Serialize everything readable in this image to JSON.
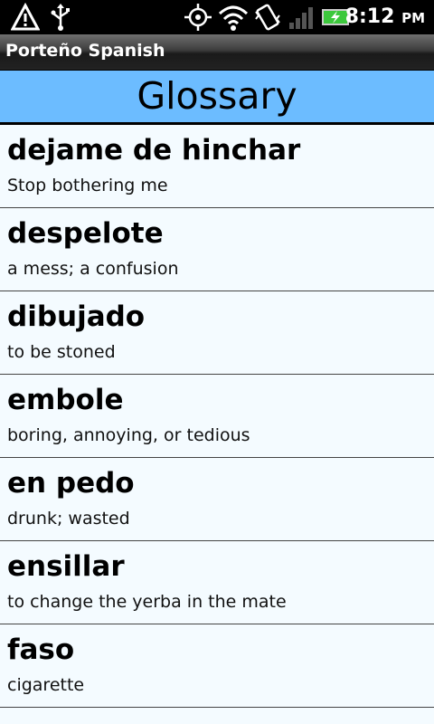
{
  "status_bar": {
    "time": "8:12",
    "ampm": "PM",
    "icons": [
      "warning-icon",
      "usb-icon",
      "gps-icon",
      "wifi-icon",
      "vibrate-icon",
      "signal-icon",
      "battery-charging-icon"
    ]
  },
  "app": {
    "title": "Porteño Spanish"
  },
  "header": {
    "title": "Glossary"
  },
  "glossary": [
    {
      "term": "dejame de hinchar",
      "definition": "Stop bothering me"
    },
    {
      "term": "despelote",
      "definition": "a mess; a confusion"
    },
    {
      "term": "dibujado",
      "definition": "to be stoned"
    },
    {
      "term": "embole",
      "definition": "boring, annoying, or tedious"
    },
    {
      "term": "en pedo",
      "definition": "drunk; wasted"
    },
    {
      "term": "ensillar",
      "definition": "to change the yerba in the mate"
    },
    {
      "term": "faso",
      "definition": "cigarette"
    }
  ],
  "colors": {
    "header_bg": "#6cbcff",
    "list_bg": "#f4fbff",
    "battery_green": "#3cc83c"
  }
}
